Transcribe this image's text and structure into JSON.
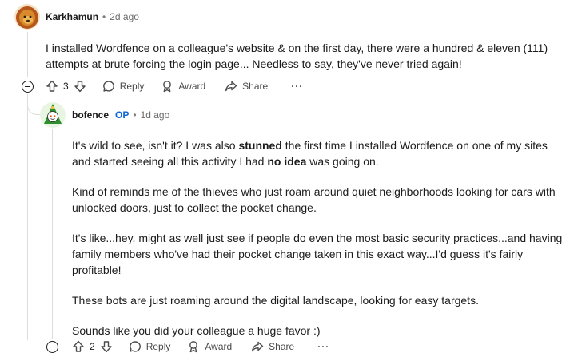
{
  "comment1": {
    "author": "Karkhamun",
    "time": "2d ago",
    "avatar_icon": "lion-avatar-icon",
    "body": "I installed Wordfence on a colleague's website & on the first day, there were a hundred & eleven (111) attempts at brute forcing the login page... Needless to say, they've never tried again!",
    "votes": "3",
    "reply_label": "Reply",
    "award_label": "Award",
    "share_label": "Share",
    "more_label": "···"
  },
  "comment2": {
    "author": "bofence",
    "op_badge": "OP",
    "time": "1d ago",
    "avatar_icon": "snoo-avatar-icon",
    "p1_before": "It's wild to see, isn't it? I was also ",
    "p1_bold1": "stunned",
    "p1_mid": " the first time I installed Wordfence on one of my sites and started seeing all this activity I had ",
    "p1_bold2": "no idea",
    "p1_after": " was going on.",
    "p2": "Kind of reminds me of the thieves who just roam around quiet neighborhoods looking for cars with unlocked doors, just to collect the pocket change.",
    "p3": "It's like...hey, might as well just see if people do even the most basic security practices...and having family members who've had their pocket change taken in this exact way...I'd guess it's fairly profitable!",
    "p4": "These bots are just roaming around the digital landscape, looking for easy targets.",
    "p5": "Sounds like you did your colleague a huge favor :)",
    "votes": "2",
    "reply_label": "Reply",
    "award_label": "Award",
    "share_label": "Share",
    "more_label": "···"
  },
  "separator": "•"
}
